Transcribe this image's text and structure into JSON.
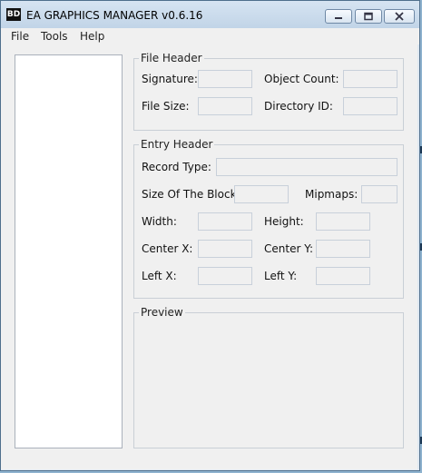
{
  "window": {
    "title": "EA GRAPHICS MANAGER v0.6.16",
    "icon_text": "BD"
  },
  "menu": [
    "File",
    "Tools",
    "Help"
  ],
  "file_header": {
    "title": "File Header",
    "signature_label": "Signature:",
    "signature_value": "",
    "object_count_label": "Object Count:",
    "object_count_value": "",
    "file_size_label": "File Size:",
    "file_size_value": "",
    "directory_id_label": "Directory ID:",
    "directory_id_value": ""
  },
  "entry_header": {
    "title": "Entry Header",
    "record_type_label": "Record Type:",
    "record_type_value": "",
    "block_size_label": "Size Of The Block:",
    "block_size_value": "",
    "mipmaps_label": "Mipmaps:",
    "mipmaps_value": "",
    "width_label": "Width:",
    "width_value": "",
    "height_label": "Height:",
    "height_value": "",
    "center_x_label": "Center X:",
    "center_x_value": "",
    "center_y_label": "Center Y:",
    "center_y_value": "",
    "left_x_label": "Left X:",
    "left_x_value": "",
    "left_y_label": "Left Y:",
    "left_y_value": ""
  },
  "preview": {
    "title": "Preview"
  },
  "icons": {
    "app": "bd-app-icon",
    "minimize": "minimize-icon",
    "maximize": "maximize-icon",
    "close": "close-icon"
  }
}
